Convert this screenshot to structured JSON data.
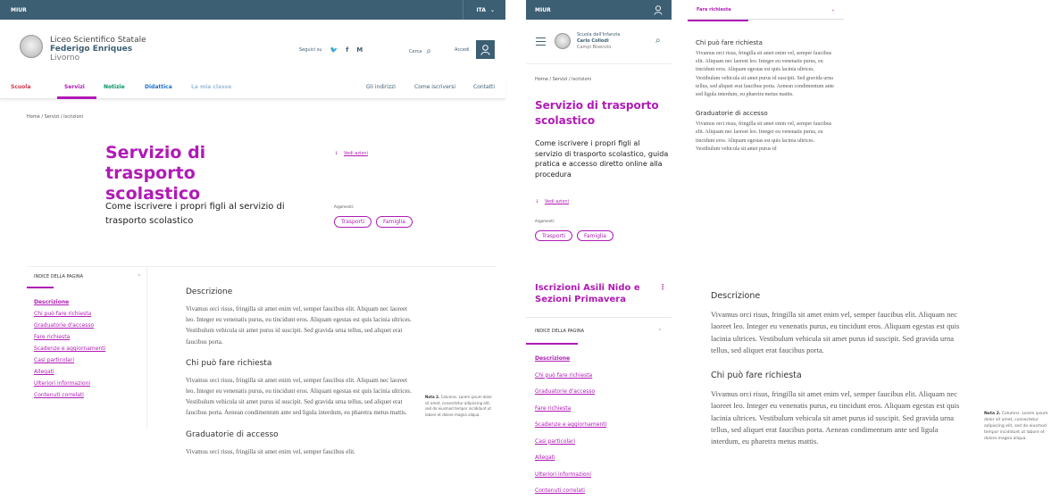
{
  "colors": {
    "topbar": "#3d5f73",
    "accent": "#b01ab5",
    "green": "#00945e",
    "link_blue": "#1d6fc7"
  },
  "desktop": {
    "topbar": {
      "org": "MIUR",
      "lang": "ITA"
    },
    "header": {
      "line1": "Liceo Scientifico Statale",
      "line2": "Federigo Enriques",
      "line3": "Livorno",
      "follow": "Seguici su",
      "social": [
        "twitter-icon",
        "facebook-icon",
        "medium-icon"
      ],
      "social_glyphs": [
        "🐦",
        "f",
        "M"
      ],
      "search": "Cerca",
      "login": "Accedi"
    },
    "nav": {
      "items": [
        "Scuola",
        "Servizi",
        "Notizie",
        "Didattica",
        "La mia classe"
      ],
      "right": [
        "Gli indirizzi",
        "Come iscriversi",
        "Contatti"
      ]
    },
    "breadcrumb": "Home / Servizi / Iscrizioni",
    "title": "Servizio di trasporto scolastico",
    "subtitle": "Come iscrivere i propri figli al servizio di trasporto scolastico",
    "actions": "Vedi azioni",
    "argomenti_label": "Argomenti:",
    "tags": [
      "Trasporti",
      "Famiglia"
    ],
    "toc": {
      "header": "INDICE DELLA PAGINA",
      "items": [
        "Descrizione",
        "Chi può fare richiesta",
        "Graduatorie d'accesso",
        "Fare richiesta",
        "Scadenze e aggiornamenti",
        "Casi particolari",
        "Allegati",
        "Ulteriori informazioni",
        "Contenuti correlati"
      ]
    },
    "sections": [
      {
        "title": "Descrizione",
        "text": "Vivamus orci risus, fringilla sit amet enim vel, semper faucibus elit. Aliquam nec laoreet leo. Integer eu venenatis purus, eu tincidunt eros. Aliquam egestas est quis lacinia ultrices. Vestibulum vehicula sit amet purus id suscipit. Sed gravida urna tellus, sed aliquet erat faucibus porta."
      },
      {
        "title": "Chi può fare richiesta",
        "text": "Vivamus orci risus, fringilla sit amet enim vel, semper faucibus elit. Aliquam nec laoreet leo. Integer eu venenatis purus, eu tincidunt eros. Aliquam egestas est quis lacinia ultrices. Vestibulum vehicula sit amet purus id suscipit. Sed gravida urna tellus, sed aliquet erat faucibus porta. Aenean condimentum ante sed ligula interdum, eu pharetra metus mattis."
      },
      {
        "title": "Graduatorie di accesso",
        "text": "Vivamus orci risus, fringilla sit amet enim vel, semper faucibus elit."
      }
    ],
    "note": {
      "label": "Nota 2.",
      "text": "Columns. Lorem ipsum dolor sit amet, consectetur adipiscing elit, sed do eiusmod tempor incididunt ut labore et dolore magna aliqua."
    }
  },
  "mobile": {
    "topbar": {
      "org": "MIUR"
    },
    "header": {
      "line1": "Scuola dell'Infanzia",
      "line2": "Carlo Collodi",
      "line3": "Campi Bisenzio"
    },
    "breadcrumb": "Home / Servizi / Iscrizioni",
    "title": "Servizio di trasporto scolastico",
    "subtitle": "Come iscrivere i propri figli al servizio di trasporto scolastico, guida pratica e accesso diretto online alla procedura",
    "actions": "Vedi azioni",
    "argomenti_label": "Argomenti:",
    "tags": [
      "Trasporti",
      "Famiglia"
    ]
  },
  "accordion": {
    "header": "Fare richiesta",
    "sections": [
      {
        "title": "Chi può fare richiesta",
        "text": "Vivamus orci risus, fringilla sit amet enim vel, semper faucibus elit. Aliquam nec laoreet leo. Integer eu venenatis purus, eu tincidunt eros. Aliquam egestas est quis lacinia ultrices. Vestibulum vehicula sit amet purus id suscipit. Sed gravida urna tellus, sed aliquet erat faucibus porta. Aenean condimentum ante sed ligula interdum, eu pharetra metus mattis."
      },
      {
        "title": "Graduatorie di accesso",
        "text": "Vivamus orci risus, fringilla sit amet enim vel, semper faucibus elit. Aliquam nec laoreet leo. Integer eu venenatis purus, eu tincidunt eros. Aliquam egestas est quis lacinia ultrices. Vestibulum vehicula sit amet purus id"
      }
    ]
  },
  "mobile_toc": {
    "title": "Iscrizioni Asili Nido e Sezioni Primavera",
    "header": "INDICE DELLA PAGINA",
    "items": [
      "Descrizione",
      "Chi può fare richiesta",
      "Graduatorie d'accesso",
      "Fare richiesta",
      "Scadenze e aggiornamenti",
      "Casi particolari",
      "Allegati",
      "Ulteriori informazioni",
      "Contenuti correlati"
    ]
  },
  "zoom": {
    "sections": [
      {
        "title": "Descrizione",
        "text": "Vivamus orci risus, fringilla sit amet enim vel, semper faucibus elit. Aliquam nec laoreet leo. Integer eu venenatis purus, eu tincidunt eros. Aliquam egestas est quis lacinia ultrices. Vestibulum vehicula sit amet purus id suscipit. Sed gravida urna tellus, sed aliquet erat faucibus porta."
      },
      {
        "title": "Chi può fare richiesta",
        "text": "Vivamus orci risus, fringilla sit amet enim vel, semper faucibus elit. Aliquam nec laoreet leo. Integer eu venenatis purus, eu tincidunt eros. Aliquam egestas est quis lacinia ultrices. Vestibulum vehicula sit amet purus id suscipit. Sed gravida urna tellus, sed aliquet erat faucibus porta. Aenean condimentum ante sed ligula interdum, eu pharetra metus mattis."
      }
    ],
    "note": {
      "label": "Nota 2.",
      "text": "Columns. Lorem ipsum dolor sit amet, consectetur adipiscing elit, sed do eiusmod tempor incididunt ut labore et dolore magna aliqua."
    }
  }
}
